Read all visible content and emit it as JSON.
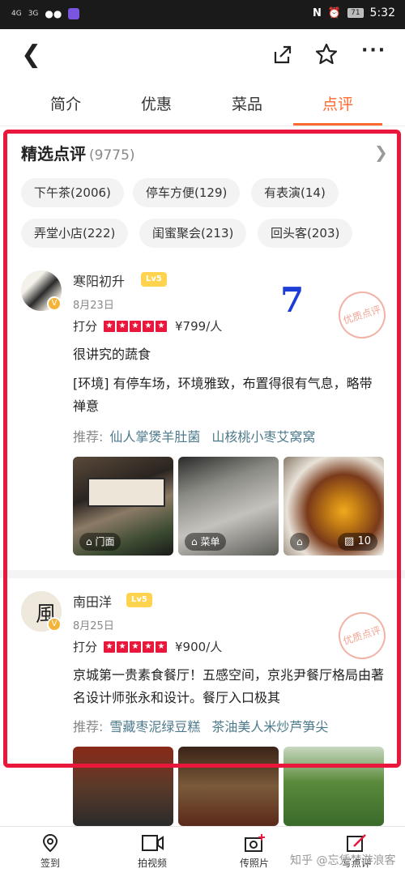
{
  "status": {
    "signal1": "4G",
    "signal2": "3G",
    "battery": "71",
    "time": "5:32"
  },
  "tabs": [
    "简介",
    "优惠",
    "菜品",
    "点评"
  ],
  "section": {
    "title": "精选点评",
    "count": "(9775)"
  },
  "chips": [
    "下午茶(2006)",
    "停车方便(129)",
    "有表演(14)",
    "弄堂小店(222)",
    "闺蜜聚会(213)",
    "回头客(203)"
  ],
  "annotation": "7",
  "reviews": [
    {
      "name": "寒阳初升",
      "level": "Lv5",
      "date": "8月23日",
      "score_label": "打分",
      "price": "¥799/人",
      "text1": "很讲究的蔬食",
      "text2": "[环境] 有停车场，环境雅致，布置得很有气息，略带禅意",
      "rec_label": "推荐:",
      "rec_items": [
        "仙人掌煲羊肚菌",
        "山核桃小枣艾窝窝"
      ],
      "stamp": "优质点评",
      "photos": [
        {
          "tag": "门面"
        },
        {
          "tag": "菜单"
        },
        {
          "tag": "10"
        }
      ]
    },
    {
      "name": "南田洋",
      "level": "Lv5",
      "date": "8月25日",
      "score_label": "打分",
      "price": "¥900/人",
      "text1": "京城第一贵素食餐厅！五感空间，京兆尹餐厅格局由著名设计师张永和设计。餐厅入口极其",
      "rec_label": "推荐:",
      "rec_items": [
        "雪藏枣泥绿豆糕",
        "茶油美人米炒芦笋尖"
      ],
      "stamp": "优质点评"
    }
  ],
  "bottom_nav": [
    "签到",
    "拍视频",
    "传照片",
    "写点评"
  ],
  "watermark": "知乎 @忘凭梦游浪客"
}
